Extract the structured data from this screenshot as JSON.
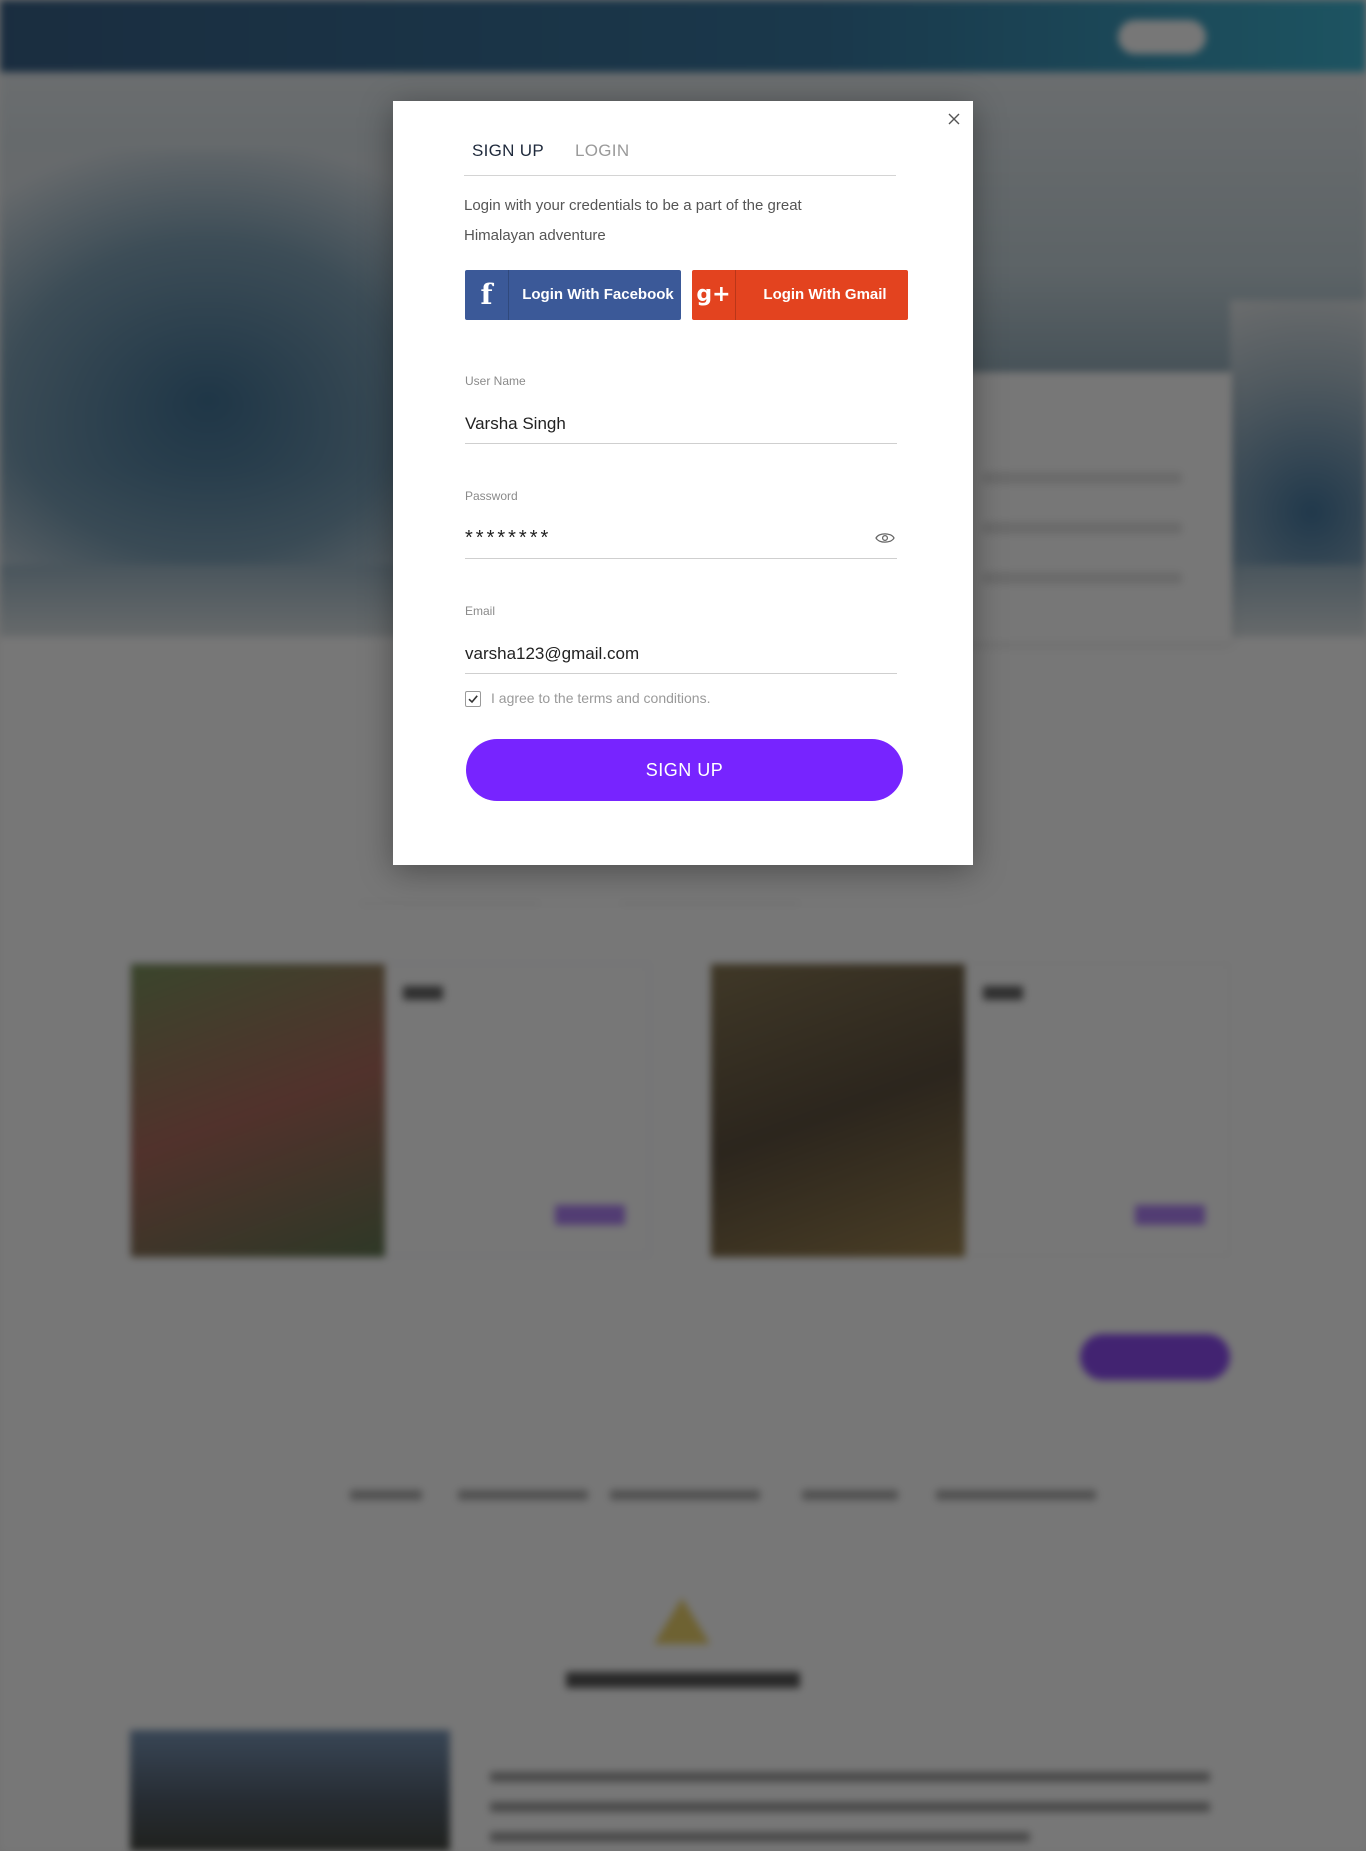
{
  "background": {
    "header": {
      "brand_small": "",
      "brand": "",
      "tagline": "",
      "login_label": "",
      "signup_label": ""
    }
  },
  "modal": {
    "tabs": {
      "signup": "SIGN UP",
      "login": "LOGIN"
    },
    "intro": "Login with your credentials to be a part of the great Himalayan adventure",
    "social": {
      "facebook": {
        "icon": "facebook-icon",
        "label": "Login With Facebook",
        "color": "#3b5998"
      },
      "gmail": {
        "icon": "google-plus-icon",
        "label": "Login With Gmail",
        "color": "#e3431f"
      }
    },
    "fields": {
      "username": {
        "label": "User Name",
        "value": "Varsha Singh"
      },
      "password": {
        "label": "Password",
        "value": "********"
      },
      "email": {
        "label": "Email",
        "value": "varsha123@gmail.com"
      }
    },
    "agree_text": "I agree to the terms and conditions.",
    "agree_checked": true,
    "submit_label": "SIGN UP",
    "accent_color": "#7724ff"
  }
}
